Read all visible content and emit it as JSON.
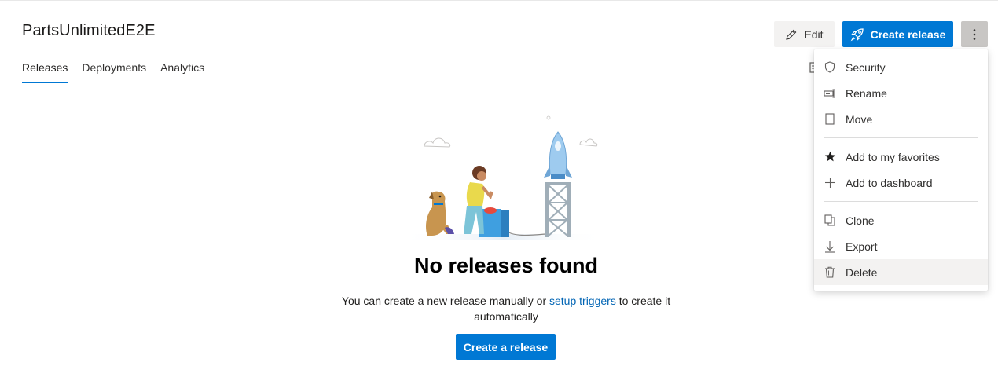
{
  "header": {
    "title": "PartsUnlimitedE2E",
    "edit_label": "Edit",
    "create_release_label": "Create release"
  },
  "tabs": [
    {
      "label": "Releases",
      "active": true
    },
    {
      "label": "Deployments",
      "active": false
    },
    {
      "label": "Analytics",
      "active": false
    }
  ],
  "more_menu": {
    "items": [
      {
        "label": "Security",
        "icon": "shield-icon"
      },
      {
        "label": "Rename",
        "icon": "rename-icon"
      },
      {
        "label": "Move",
        "icon": "move-icon"
      },
      {
        "label": "Add to my favorites",
        "icon": "star-icon"
      },
      {
        "label": "Add to dashboard",
        "icon": "plus-icon"
      },
      {
        "label": "Clone",
        "icon": "clone-icon"
      },
      {
        "label": "Export",
        "icon": "download-icon"
      },
      {
        "label": "Delete",
        "icon": "trash-icon"
      }
    ]
  },
  "empty_state": {
    "title": "No releases found",
    "desc_before": "You can create a new release manually or ",
    "desc_link": "setup triggers",
    "desc_after": " to create it automatically",
    "button_label": "Create a release"
  },
  "colors": {
    "accent": "#0078d4",
    "link": "#0064b4"
  }
}
